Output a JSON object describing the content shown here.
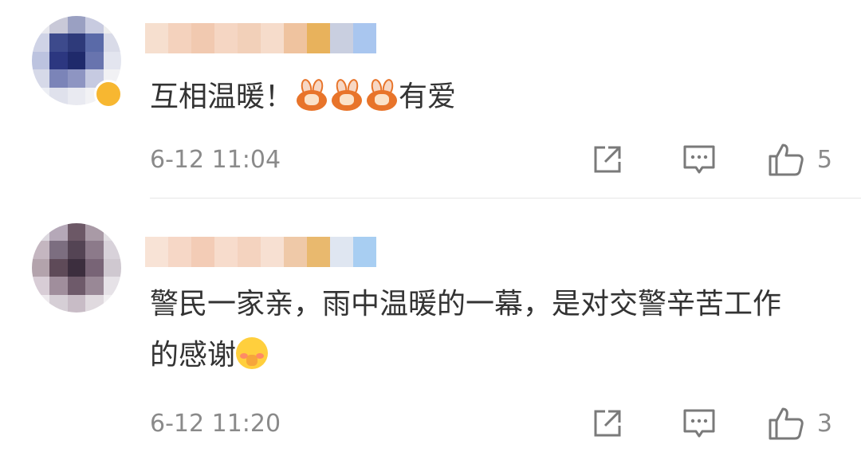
{
  "comments": [
    {
      "text_before": "互相温暖！",
      "text_after": "有爱",
      "emoji": "rabbit-heart-emoji",
      "emoji_count": 3,
      "time": "6-12 11:04",
      "likes": "5",
      "avatar_colors": [
        "#e8e8ee",
        "#c9c9d8",
        "#9aa0c2",
        "#c8cbe0",
        "#eeeeee",
        "#cfd3e6",
        "#3d4a8c",
        "#2e3a7a",
        "#5a6aa8",
        "#d9dbe8",
        "#bcc3df",
        "#2c3780",
        "#1f2a6b",
        "#6874ae",
        "#e3e5ef",
        "#d6d9e8",
        "#7b84b8",
        "#8e95c2",
        "#c6cae1",
        "#f1f1f4",
        "#eceef4",
        "#dfe1ec",
        "#e9eaf1",
        "#f2f2f5",
        "#f7f7f9"
      ],
      "nickname_colors": [
        "#f6dfcf",
        "#f4d2bd",
        "#f1c9b0",
        "#f5d6c3",
        "#f2d0b9",
        "#f6dccb",
        "#efc39f",
        "#e8b25c",
        "#c9cfe0",
        "#a9c6ef"
      ]
    },
    {
      "text": "警民一家亲，雨中温暖的一幕，是对交警辛苦工作的感谢",
      "emoji": "blush-emoji",
      "time": "6-12 11:20",
      "likes": "3",
      "avatar_colors": [
        "#dcd8df",
        "#b5a8b8",
        "#6c5866",
        "#a99aa6",
        "#e2dfe3",
        "#c4b6c0",
        "#7c6e80",
        "#544454",
        "#8c7a8a",
        "#d8d2da",
        "#b3a3ac",
        "#5e4a58",
        "#3c2e3e",
        "#786476",
        "#cfc8d0",
        "#d8cdd6",
        "#a08e9c",
        "#6e5a6a",
        "#998896",
        "#e6e2e7",
        "#eeeaee",
        "#d6cfd6",
        "#c8bcc6",
        "#e0dadf",
        "#f2f0f2"
      ],
      "nickname_colors": [
        "#f8e3d6",
        "#f6d7c6",
        "#f3ccb6",
        "#f7dccc",
        "#f4d3bf",
        "#f7e0d2",
        "#efc9a8",
        "#e9b96e",
        "#dfe6f1",
        "#a8cef2"
      ]
    }
  ],
  "icons": {
    "share": "share-icon",
    "reply": "comment-icon",
    "like": "thumbs-up-icon"
  },
  "colors": {
    "text": "#333333",
    "meta": "#8a8a8a",
    "icon": "#7a7a7a",
    "divider": "#e6e6e6"
  }
}
